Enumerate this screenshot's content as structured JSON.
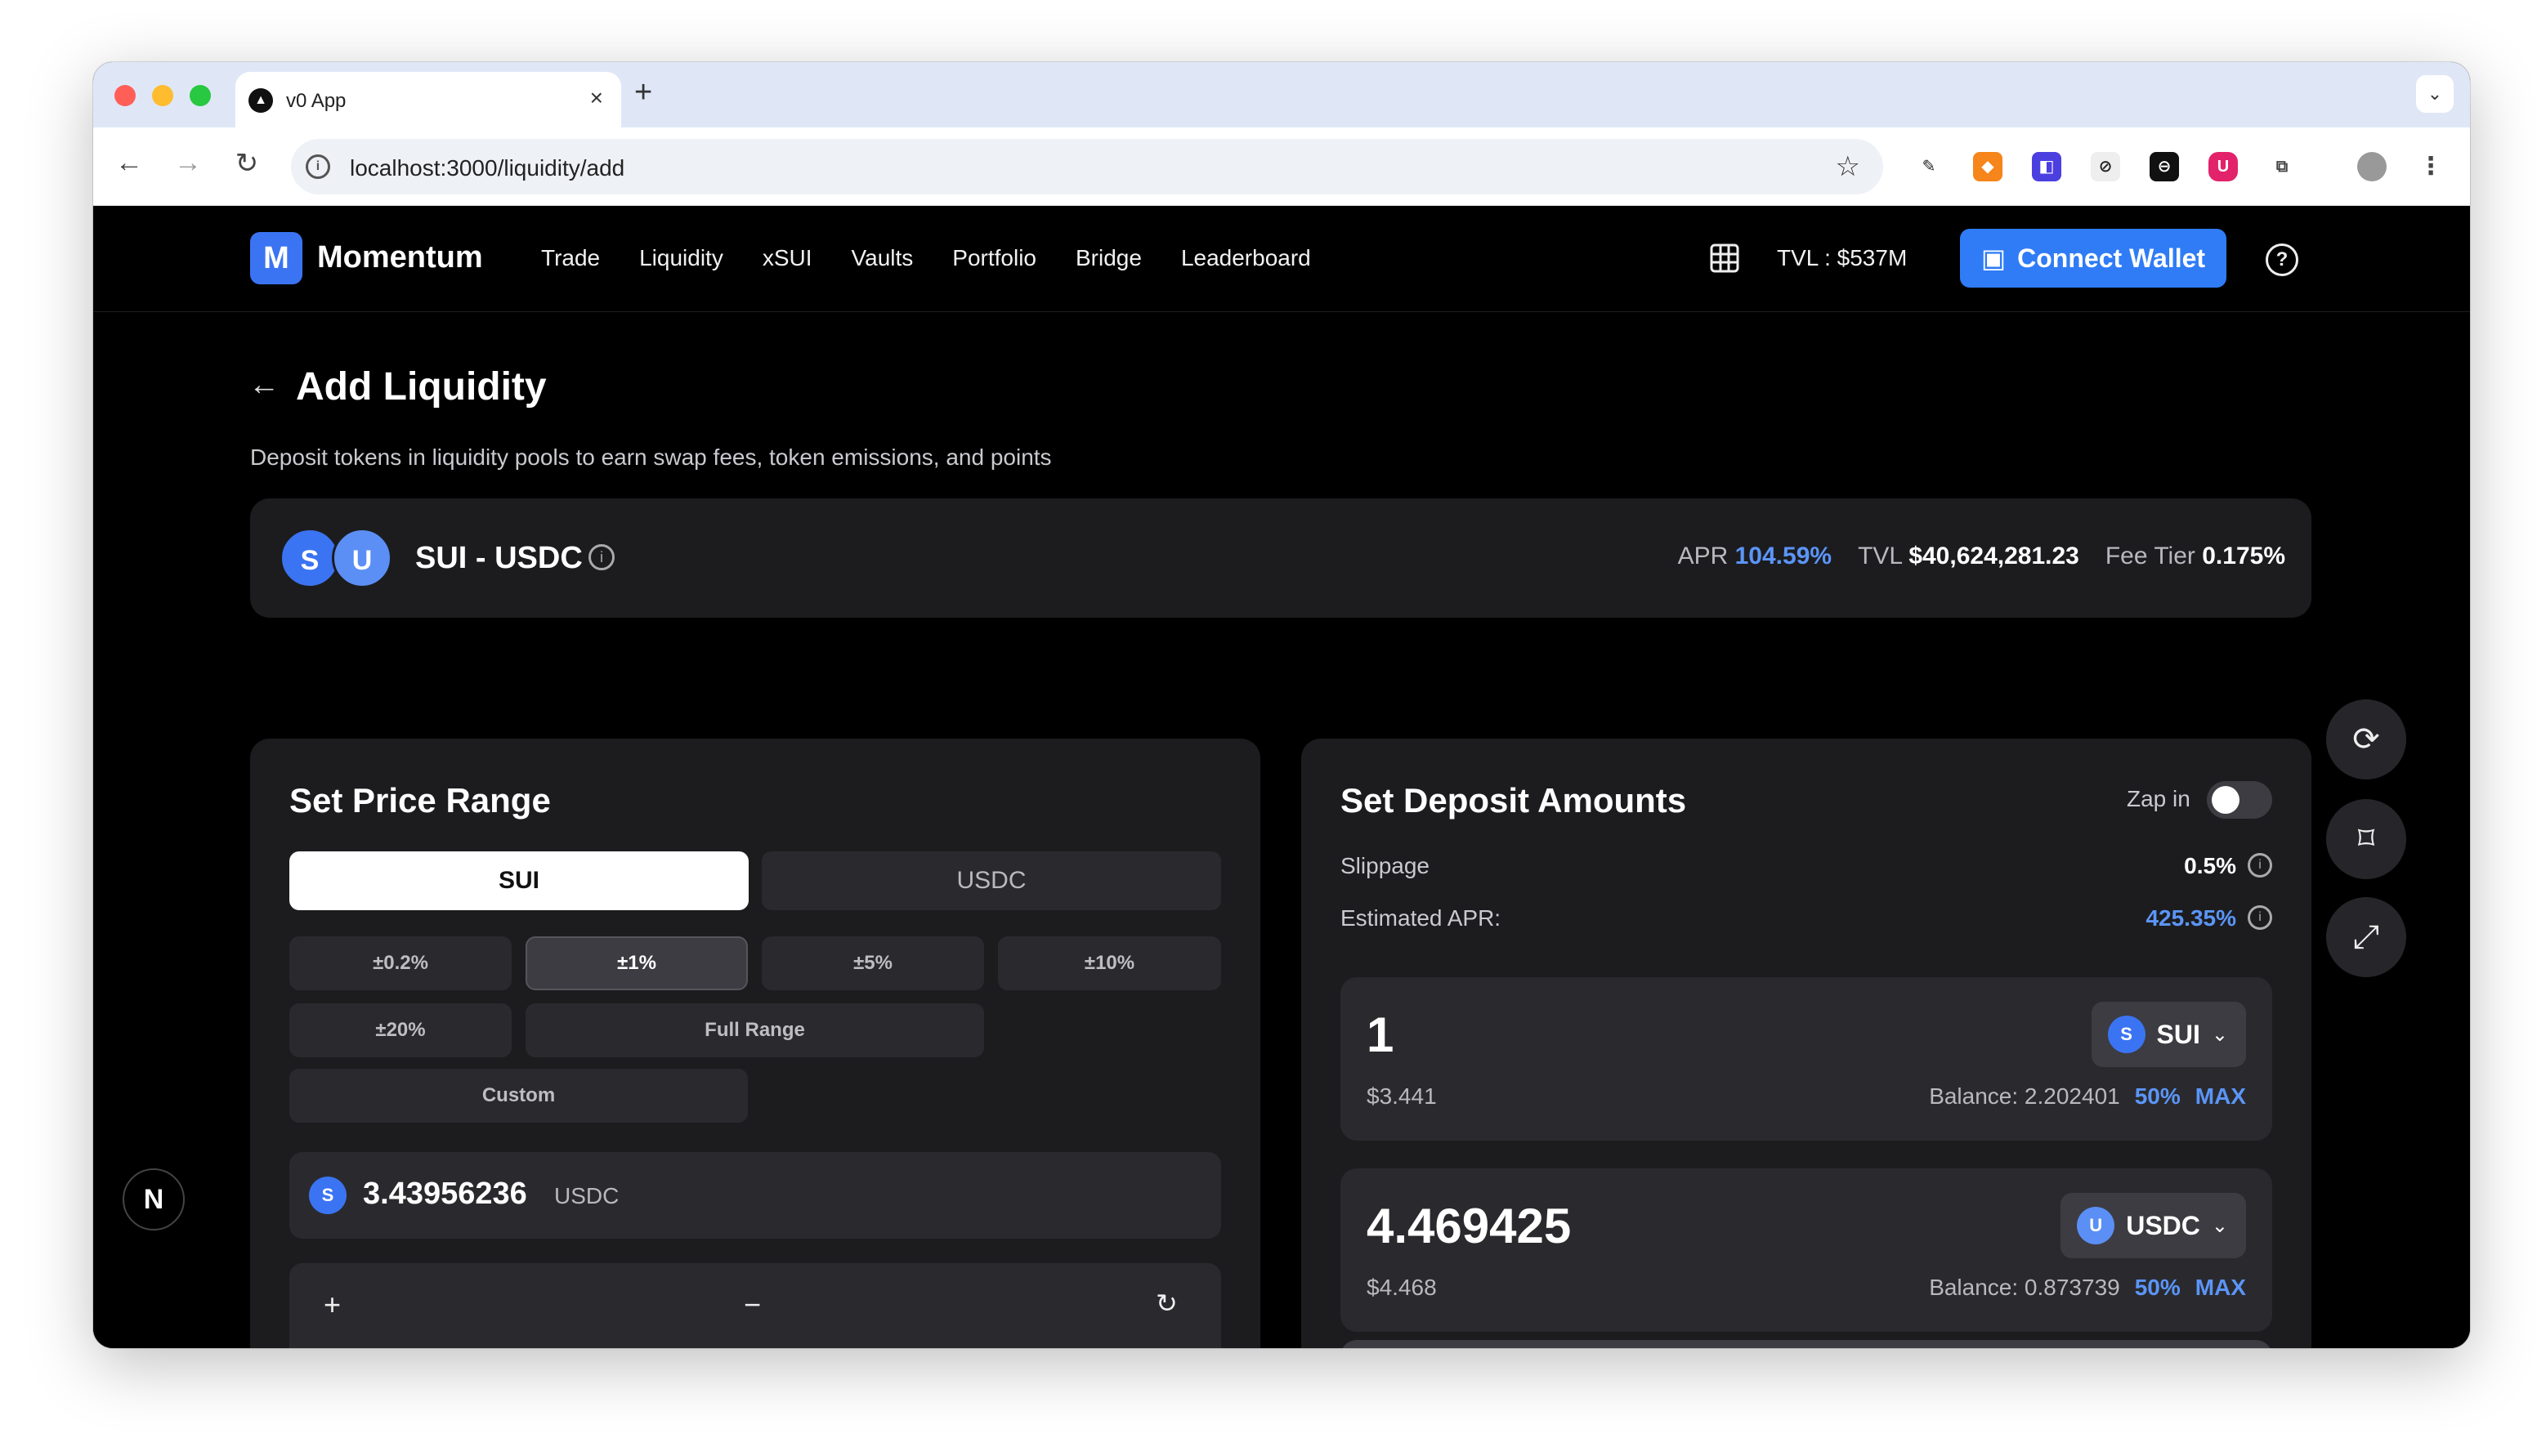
{
  "browser": {
    "tab_title": "v0 App",
    "tab_favicon": "▲",
    "url": "localhost:3000/liquidity/add"
  },
  "header": {
    "logo_mark": "M",
    "logo_text": "Momentum",
    "nav": [
      "Trade",
      "Liquidity",
      "xSUI",
      "Vaults",
      "Portfolio",
      "Bridge",
      "Leaderboard"
    ],
    "tvl": "TVL : $537M",
    "connect_wallet": "Connect Wallet"
  },
  "page": {
    "title": "Add Liquidity",
    "subtitle": "Deposit tokens in liquidity pools to earn swap fees, token emissions, and points"
  },
  "pool": {
    "coin_a": "S",
    "coin_b": "U",
    "name": "SUI - USDC",
    "apr_label": "APR",
    "apr_value": "104.59%",
    "tvl_label": "TVL",
    "tvl_value": "$40,624,281.23",
    "fee_label": "Fee Tier",
    "fee_value": "0.175%"
  },
  "price_range": {
    "title": "Set Price Range",
    "token_tabs": [
      "SUI",
      "USDC"
    ],
    "presets": [
      "±0.2%",
      "±1%",
      "±5%",
      "±10%",
      "±20%",
      "Full Range",
      "Custom"
    ],
    "active_preset": "±1%",
    "current_price_coin": "S",
    "current_price": "3.43956236",
    "current_price_unit": "USDC",
    "chart_controls": {
      "zoom_in": "+",
      "zoom_out": "−"
    }
  },
  "deposit": {
    "title": "Set Deposit Amounts",
    "zap_label": "Zap in",
    "zap_enabled": false,
    "slippage_label": "Slippage",
    "slippage_value": "0.5%",
    "apr_label": "Estimated APR:",
    "apr_value": "425.35%",
    "inputs": [
      {
        "amount": "1",
        "usd": "$3.441",
        "token": "SUI",
        "coin": "S",
        "balance": "Balance: 2.202401",
        "half": "50%",
        "max": "MAX"
      },
      {
        "amount": "4.469425",
        "usd": "$4.468",
        "token": "USDC",
        "coin": "U",
        "balance": "Balance: 0.873739",
        "half": "50%",
        "max": "MAX"
      }
    ]
  },
  "floating": {
    "badge": "N"
  },
  "colors": {
    "accent": "#2f7cf6",
    "apr_blue": "#5b95f7",
    "panel_bg": "#1c1c1f",
    "page_bg": "#000000"
  }
}
